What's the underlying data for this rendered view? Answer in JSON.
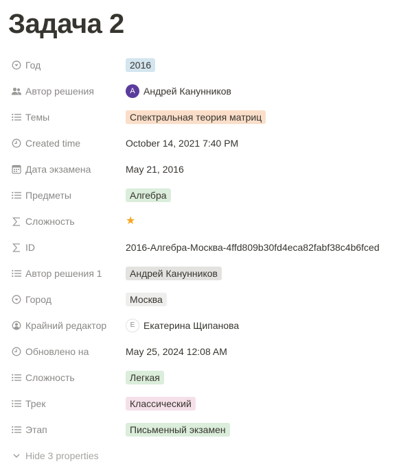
{
  "page": {
    "title": "Задача 2"
  },
  "properties": [
    {
      "label": "Год",
      "icon": "select-icon",
      "type": "tag",
      "color": "#d3e5ef",
      "value": "2016"
    },
    {
      "label": "Автор решения",
      "icon": "people-icon",
      "type": "person",
      "initial": "A",
      "value": "Андрей Канунников"
    },
    {
      "label": "Темы",
      "icon": "list-icon",
      "type": "tag",
      "color": "#fadec9",
      "value": "Спектральная теория матриц"
    },
    {
      "label": "Created time",
      "icon": "clock-icon",
      "type": "text",
      "value": "October 14, 2021 7:40 PM"
    },
    {
      "label": "Дата экзамена",
      "icon": "calendar-icon",
      "type": "text",
      "value": "May 21, 2016"
    },
    {
      "label": "Предметы",
      "icon": "list-icon",
      "type": "tag",
      "color": "#dbeddb",
      "value": "Алгебра"
    },
    {
      "label": "Сложность",
      "icon": "sigma-icon",
      "type": "rating",
      "value": "★",
      "rating": 1
    },
    {
      "label": "ID",
      "icon": "sigma-icon",
      "type": "text",
      "value": "2016-Алгебра-Москва-4ffd809b30fd4eca82fabf38c4b6fced"
    },
    {
      "label": "Автор решения 1",
      "icon": "list-icon",
      "type": "tag",
      "color": "#e3e2e0",
      "value": "Андрей Канунников"
    },
    {
      "label": "Город",
      "icon": "select-icon",
      "type": "tag",
      "color": "#eeeeec",
      "value": "Москва"
    },
    {
      "label": "Крайний редактор",
      "icon": "user-circle-icon",
      "type": "person",
      "initial": "Е",
      "value": "Екатерина Щипанова"
    },
    {
      "label": "Обновлено на",
      "icon": "clock-icon",
      "type": "text",
      "value": "May 25, 2024 12:08 AM"
    },
    {
      "label": "Сложность",
      "icon": "list-icon",
      "type": "tag",
      "color": "#dbeddb",
      "value": "Легкая"
    },
    {
      "label": "Трек",
      "icon": "list-icon",
      "type": "tag",
      "color": "#f5e0e9",
      "value": "Классический"
    },
    {
      "label": "Этап",
      "icon": "list-icon",
      "type": "tag",
      "color": "#dbeddb",
      "value": "Письменный экзамен"
    }
  ],
  "footer": {
    "hide_label": "Hide 3 properties",
    "icon": "chevron-down-icon"
  },
  "colors": {
    "text": "#37352f",
    "muted": "#8a8986",
    "icon": "#9b9a97",
    "star": "#f5a623",
    "avatar": "#5b3c9c"
  }
}
